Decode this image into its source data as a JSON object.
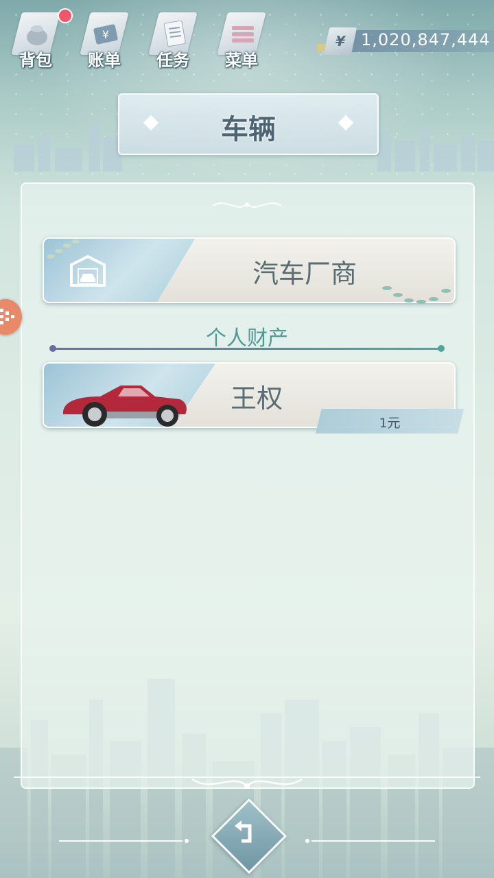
{
  "topbar": {
    "backpack_label": "背包",
    "bill_label": "账单",
    "task_label": "任务",
    "menu_label": "菜单",
    "currency_symbol": "¥",
    "money_amount": "1,020,847,444"
  },
  "header": {
    "title": "车辆"
  },
  "main": {
    "manufacturer_label": "汽车厂商",
    "section_title": "个人财产",
    "vehicle": {
      "name": "王权",
      "price": "1元"
    }
  },
  "icons": {
    "backpack": "backpack-icon",
    "bill": "bill-icon",
    "task": "task-icon",
    "menu": "menu-icon",
    "garage": "garage-icon",
    "car": "car-icon",
    "back": "back-arrow-icon",
    "side_handle": "grid-dots-icon"
  },
  "colors": {
    "notification_dot": "#f0566a",
    "section_accent": "#4f9a95",
    "side_handle": "#e88a6a",
    "car_body": "#b3283a"
  }
}
